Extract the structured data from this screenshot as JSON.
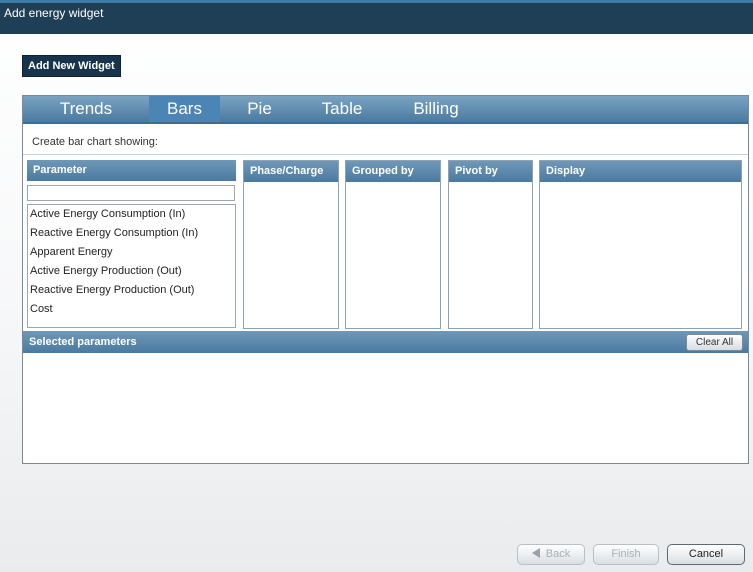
{
  "window": {
    "title": "Add energy widget"
  },
  "toolbar": {
    "add_new_label": "Add New Widget"
  },
  "tabs": [
    {
      "label": "Trends",
      "active": false
    },
    {
      "label": "Bars",
      "active": true
    },
    {
      "label": "Pie",
      "active": false
    },
    {
      "label": "Table",
      "active": false
    },
    {
      "label": "Billing",
      "active": false
    }
  ],
  "caption": "Create bar chart showing:",
  "columns": {
    "parameter": "Parameter",
    "phase": "Phase/Charge",
    "grouped": "Grouped by",
    "pivot": "Pivot by",
    "display": "Display"
  },
  "parameter_filter": {
    "value": ""
  },
  "parameters": [
    "Active Energy Consumption (In)",
    "Reactive Energy Consumption (In)",
    "Apparent Energy",
    "Active Energy Production (Out)",
    "Reactive Energy Production (Out)",
    "Cost"
  ],
  "selected": {
    "header": "Selected parameters",
    "clear_label": "Clear All"
  },
  "footer": {
    "back_label": "Back",
    "finish_label": "Finish",
    "cancel_label": "Cancel"
  },
  "colors": {
    "titlebar": "#1f3f57",
    "tab_active": "#4a85b6",
    "header": "#4a7aa0"
  }
}
